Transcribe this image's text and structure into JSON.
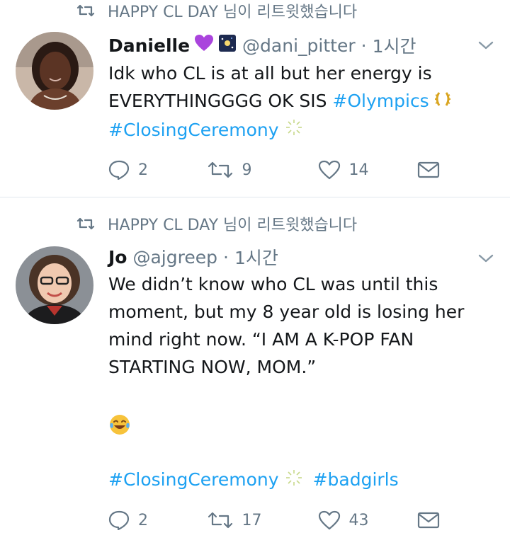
{
  "tweets": [
    {
      "retweet_label": "HAPPY CL DAY 님이 리트윗했습니다",
      "name": "Danielle",
      "handle": "@dani_pitter",
      "separator": "·",
      "time": "1시간",
      "text_line1": "Idk who CL is at all but her energy is",
      "text_line2_plain": "EVERYTHINGGGG OK SIS ",
      "hashtag1": "#Olympics",
      "hashtag2": "#ClosingCeremony",
      "replies": "2",
      "retweets": "9",
      "likes": "14",
      "icons": [
        "purple-heart-emoji",
        "sparkle-space-emoji",
        "laurel-emoji",
        "fireworks-emoji"
      ]
    },
    {
      "retweet_label": "HAPPY CL DAY 님이 리트윗했습니다",
      "name": "Jo",
      "handle": "@ajgreep",
      "separator": "·",
      "time": "1시간",
      "text_line1": "We didn’t know who CL was until this",
      "text_line2": "moment, but my 8 year old is losing her",
      "text_line3": "mind right now. “I AM A K-POP FAN",
      "text_line4": "STARTING NOW, MOM.”",
      "hashtag1": "#ClosingCeremony",
      "hashtag2": "#badgirls",
      "replies": "2",
      "retweets": "17",
      "likes": "43",
      "icons": [
        "tears-of-joy-emoji",
        "fireworks-emoji"
      ]
    }
  ],
  "colors": {
    "link": "#1da1f2",
    "secondary": "#657786",
    "divider": "#e1e8ed"
  }
}
